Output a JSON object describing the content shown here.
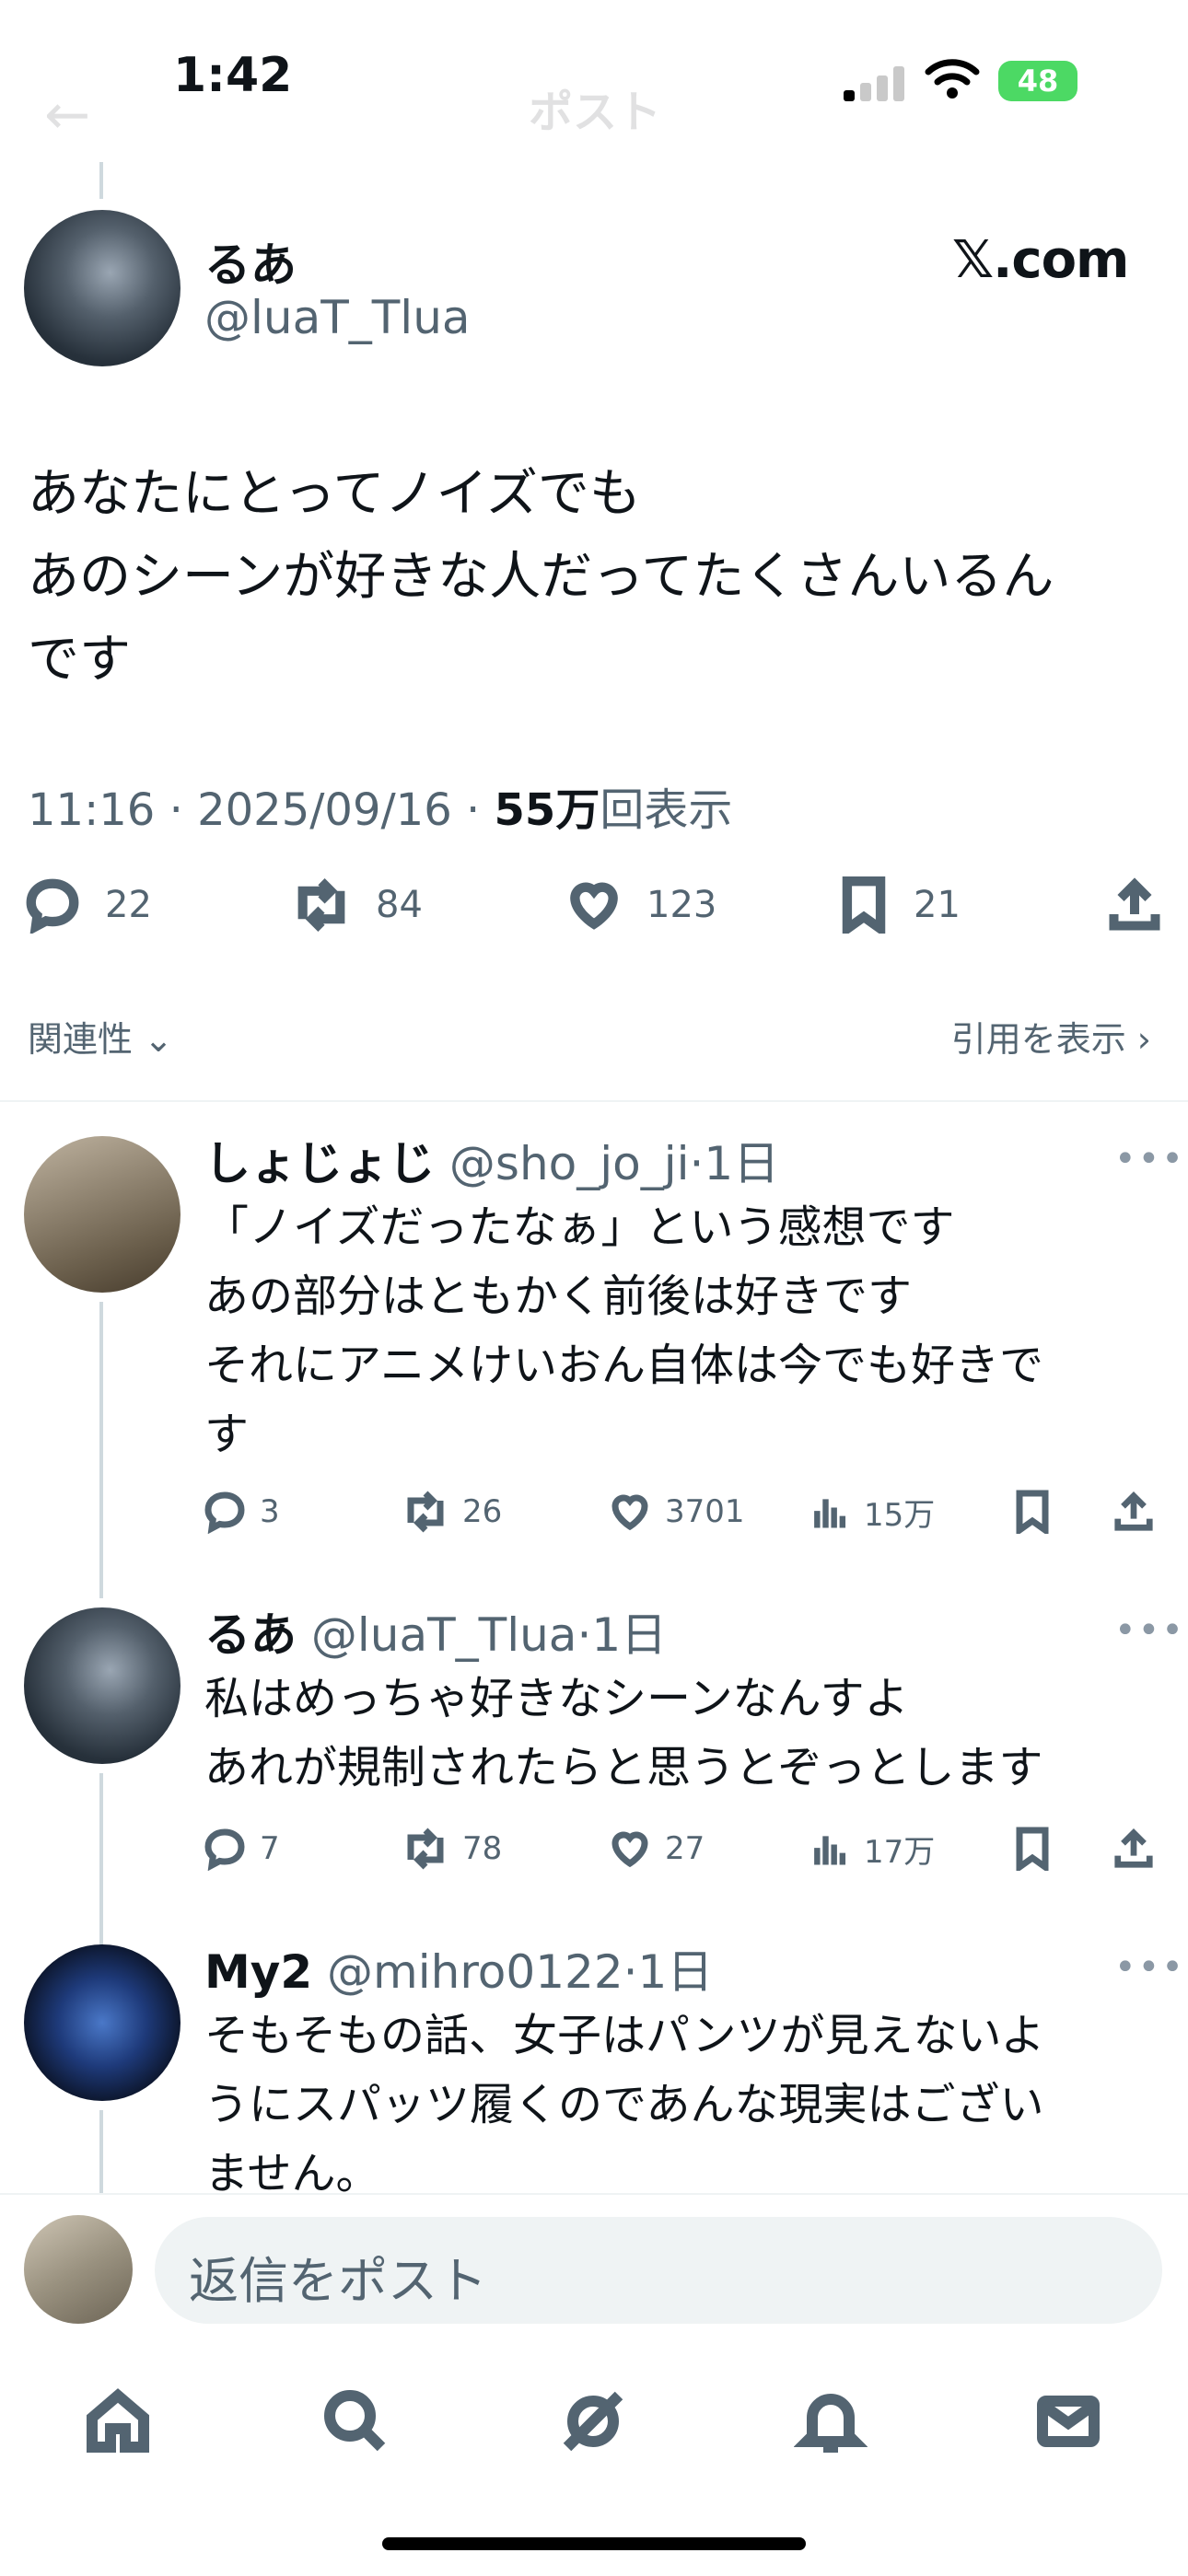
{
  "status_bar": {
    "time": "1:42",
    "battery": "48"
  },
  "header": {
    "title": "ポスト"
  },
  "main_post": {
    "display_name": "るあ",
    "handle": "@luaT_Tlua",
    "source": "𝕏.com",
    "text_lines": [
      "あなたにとってノイズでも",
      "あのシーンが好きな人だってたくさんいるん",
      "です"
    ],
    "time": "11:16 · 2025/09/16 · ",
    "views_count": "55万",
    "views_label": "回表示",
    "stats": {
      "replies": "22",
      "reposts": "84",
      "likes": "123",
      "bookmarks": "21"
    }
  },
  "sort": {
    "label": "関連性",
    "quotes_label": "引用を表示"
  },
  "replies": [
    {
      "display_name": "しょじょじ",
      "handle": "@sho_jo_ji",
      "age": "·1日",
      "text_lines": [
        "「ノイズだったなぁ」という感想です",
        "あの部分はともかく前後は好きです",
        "それにアニメけいおん自体は今でも好きで",
        "す"
      ],
      "replies": "3",
      "reposts": "26",
      "likes": "3701",
      "views": "15万"
    },
    {
      "display_name": "るあ",
      "handle": "@luaT_Tlua",
      "age": "·1日",
      "text_lines": [
        "私はめっちゃ好きなシーンなんすよ",
        "あれが規制されたらと思うとぞっとします"
      ],
      "replies": "7",
      "reposts": "78",
      "likes": "27",
      "views": "17万"
    },
    {
      "display_name": "My2",
      "handle": "@mihro0122",
      "age": "·1日",
      "text_lines": [
        "そもそもの話、女子はパンツが見えないよ",
        "うにスパッツ履くのであんな現実はござい",
        "ません。"
      ]
    }
  ],
  "composer": {
    "placeholder": "返信をポスト"
  },
  "tab_bar": {
    "icons": [
      "home-icon",
      "search-icon",
      "grok-icon",
      "notifications-icon",
      "messages-icon"
    ]
  }
}
